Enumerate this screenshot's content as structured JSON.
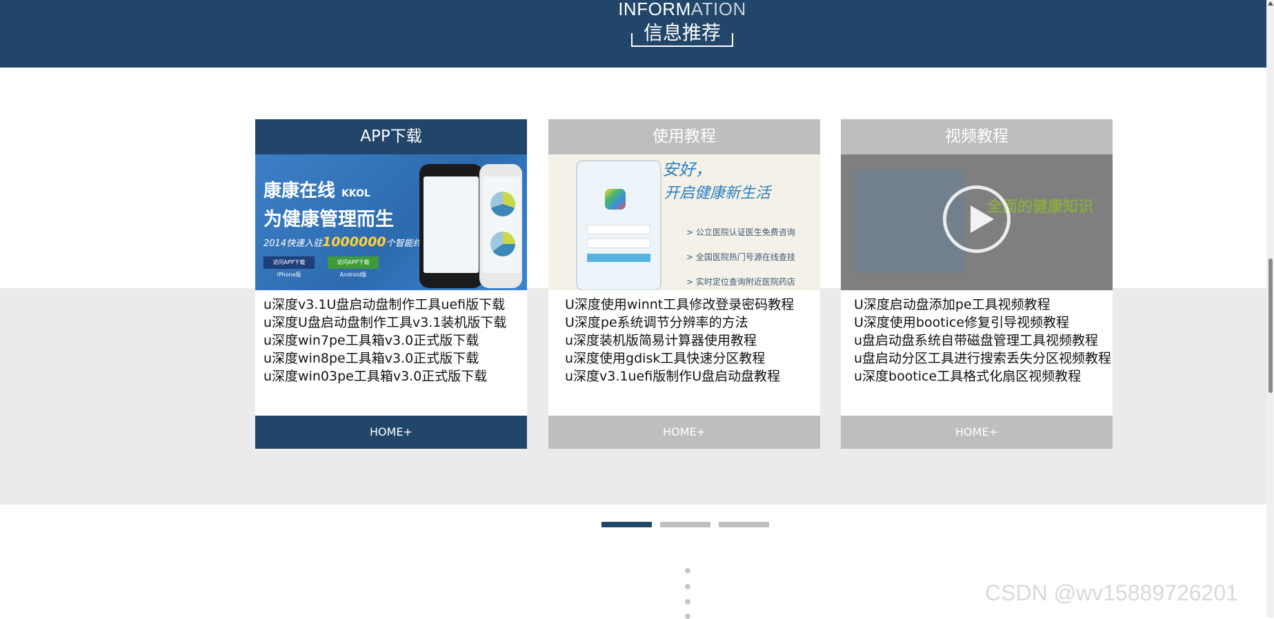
{
  "header": {
    "title_en_main": "INFORM",
    "title_en_fade": "ATION",
    "title_cn": "信息推荐"
  },
  "cards": [
    {
      "title": "APP下载",
      "state": "active",
      "image": {
        "line1": "康康在线",
        "line1_small": "KKOL",
        "line2": "为健康管理而生",
        "line3_prefix": "2014快速入驻",
        "line3_number": "1000000",
        "line3_suffix": "个智能终端",
        "btn_ios": "访问APP下载 iPhone版",
        "btn_android": "访问APP下载 Android版"
      },
      "items": [
        "u深度v3.1U盘启动盘制作工具uefi版下载",
        "u深度U盘启动盘制作工具v3.1装机版下载",
        "u深度win7pe工具箱v3.0正式版下载",
        "u深度win8pe工具箱v3.0正式版下载",
        "u深度win03pe工具箱v3.0正式版下载"
      ],
      "footer": "HOME+"
    },
    {
      "title": "使用教程",
      "state": "inactive",
      "image": {
        "hand1": "安好，",
        "hand2": "开启健康新生活",
        "bullets": [
          "> 公立医院认证医生免费咨询",
          "> 全国医院热门号源在线查挂",
          "> 实时定位查询附近医院药店"
        ]
      },
      "items": [
        "U深度使用winnt工具修改登录密码教程",
        "U深度pe系统调节分辨率的方法",
        "u深度装机版简易计算器使用教程",
        "u深度使用gdisk工具快速分区教程",
        "u深度v3.1uefi版制作U盘启动盘教程"
      ],
      "footer": "HOME+"
    },
    {
      "title": "视频教程",
      "state": "inactive",
      "image": {
        "headline": "全面的健康知识"
      },
      "items": [
        "U深度启动盘添加pe工具视频教程",
        "U深度使用bootice修复引导视频教程",
        "u盘启动盘系统自带磁盘管理工具视频教程",
        "u盘启动分区工具进行搜索丢失分区视频教程",
        "u深度bootice工具格式化扇区视频教程"
      ],
      "footer": "HOME+"
    }
  ],
  "pager": {
    "pages": 3,
    "active_index": 0,
    "colors": {
      "active": "#21466a",
      "inactive": "#bebebe"
    }
  },
  "watermark": "CSDN @wv15889726201",
  "colors": {
    "brand": "#21466a",
    "band": "#ebebeb"
  }
}
